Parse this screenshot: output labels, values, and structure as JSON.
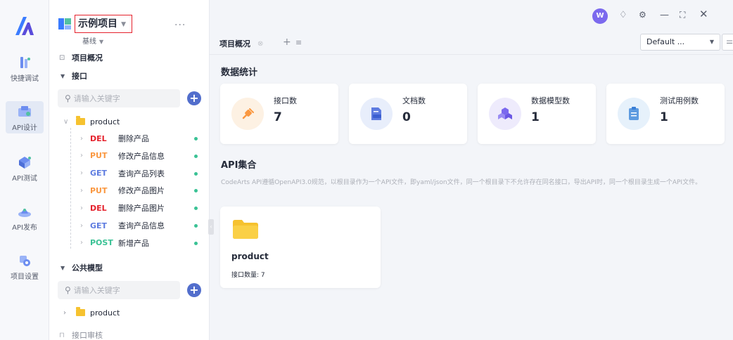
{
  "rail": {
    "items": [
      {
        "label": "快捷调试",
        "icon": "quick-debug-icon"
      },
      {
        "label": "API设计",
        "icon": "api-design-icon"
      },
      {
        "label": "API测试",
        "icon": "api-test-icon"
      },
      {
        "label": "API发布",
        "icon": "api-publish-icon"
      },
      {
        "label": "项目设置",
        "icon": "project-settings-icon"
      }
    ]
  },
  "sidebar": {
    "project_name": "示例项目",
    "baseline_label": "基线",
    "overview_label": "项目概况",
    "interfaces_label": "接口",
    "search_placeholder": "请输入关键字",
    "folder_name": "product",
    "apis": [
      {
        "method": "DEL",
        "name": "删除产品"
      },
      {
        "method": "PUT",
        "name": "修改产品信息"
      },
      {
        "method": "GET",
        "name": "查询产品列表"
      },
      {
        "method": "PUT",
        "name": "修改产品图片"
      },
      {
        "method": "DEL",
        "name": "删除产品图片"
      },
      {
        "method": "GET",
        "name": "查询产品信息"
      },
      {
        "method": "POST",
        "name": "新增产品"
      }
    ],
    "public_models_label": "公共模型",
    "models_search_placeholder": "请输入关键字",
    "models_folder_name": "product",
    "review_label": "接口审核"
  },
  "header": {
    "avatar_initial": "W",
    "tab_label": "项目概况",
    "env_value": "Default ..."
  },
  "stats": {
    "title": "数据统计",
    "cards": [
      {
        "label": "接口数",
        "value": "7",
        "color": "#fa9841",
        "bg": "#fdf1e3",
        "icon": "plug-icon"
      },
      {
        "label": "文档数",
        "value": "0",
        "color": "#5e7ce0",
        "bg": "#e8eefb",
        "icon": "doc-icon"
      },
      {
        "label": "数据模型数",
        "value": "1",
        "color": "#7b69ee",
        "bg": "#eeebfc",
        "icon": "cubes-icon"
      },
      {
        "label": "测试用例数",
        "value": "1",
        "color": "#5e9be0",
        "bg": "#e6f1fb",
        "icon": "clipboard-icon"
      }
    ]
  },
  "collections": {
    "title": "API集合",
    "description": "CodeArts API遵循OpenAPI3.0规范，以根目录作为一个API文件，即yaml/json文件，同一个根目录下不允许存在同名接口，导出API时，同一个根目录生成一个API文件。",
    "cards": [
      {
        "name": "product",
        "count_label": "接口数量: 7"
      }
    ]
  }
}
